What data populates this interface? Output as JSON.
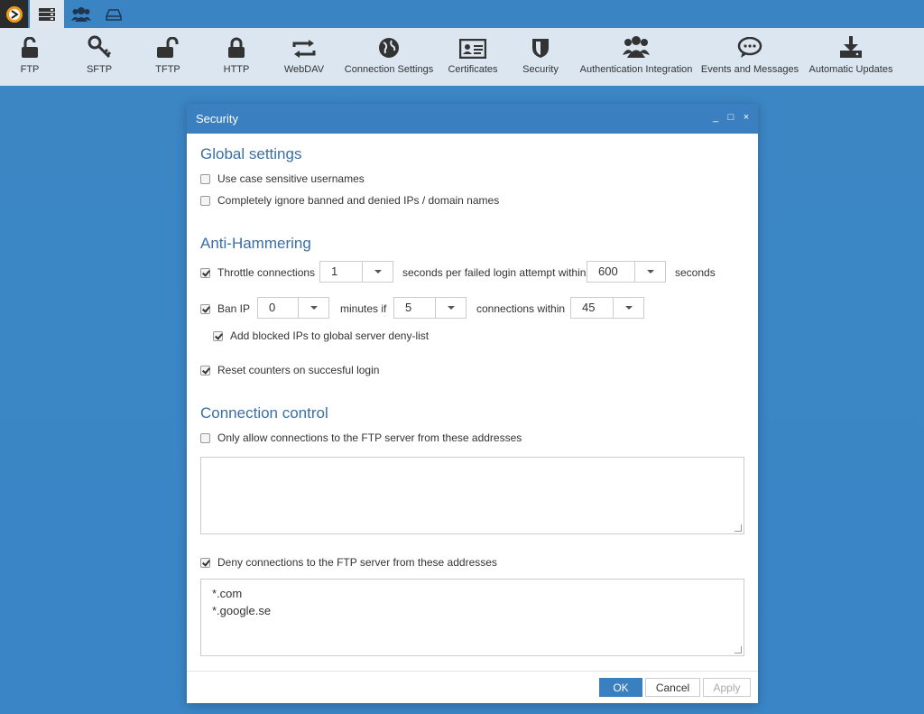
{
  "topbar": {
    "tabs": [
      "servers-icon",
      "users-icon",
      "drive-icon"
    ]
  },
  "toolbar": {
    "items": [
      {
        "label": "FTP",
        "icon": "lock-open-icon"
      },
      {
        "label": "SFTP",
        "icon": "key-icon"
      },
      {
        "label": "TFTP",
        "icon": "lock-open-icon"
      },
      {
        "label": "HTTP",
        "icon": "lock-icon"
      },
      {
        "label": "WebDAV",
        "icon": "sync-icon"
      },
      {
        "label": "Connection Settings",
        "icon": "globe-icon"
      },
      {
        "label": "Certificates",
        "icon": "id-card-icon"
      },
      {
        "label": "Security",
        "icon": "shield-icon"
      },
      {
        "label": "Authentication Integration",
        "icon": "users-icon"
      },
      {
        "label": "Events and Messages",
        "icon": "chat-icon"
      },
      {
        "label": "Automatic Updates",
        "icon": "download-icon"
      }
    ]
  },
  "dialog": {
    "title": "Security",
    "controls": [
      "_",
      "□",
      "×"
    ],
    "global": {
      "heading": "Global settings",
      "case_sensitive": {
        "label": "Use case sensitive usernames",
        "checked": false
      },
      "ignore_banned": {
        "label": "Completely ignore banned and denied IPs / domain names",
        "checked": false
      }
    },
    "anti": {
      "heading": "Anti-Hammering",
      "throttle": {
        "label": "Throttle connections",
        "checked": true,
        "value": "1",
        "mid": "seconds per failed login attempt within",
        "value2": "600",
        "end": "seconds"
      },
      "ban": {
        "label": "Ban IP",
        "checked": true,
        "value": "0",
        "mid": "minutes if",
        "value2": "5",
        "mid2": "connections within",
        "value3": "45"
      },
      "add_blocked": {
        "label": "Add blocked IPs to global server deny-list",
        "checked": true
      },
      "reset": {
        "label": "Reset counters on succesful login",
        "checked": true
      }
    },
    "conn": {
      "heading": "Connection control",
      "allow": {
        "label": "Only allow connections to the FTP server from these addresses",
        "checked": false,
        "lines": []
      },
      "deny": {
        "label": "Deny connections to the FTP server from these addresses",
        "checked": true,
        "lines": [
          "*.com",
          "*.google.se"
        ]
      }
    },
    "buttons": {
      "ok": "OK",
      "cancel": "Cancel",
      "apply": "Apply"
    }
  }
}
